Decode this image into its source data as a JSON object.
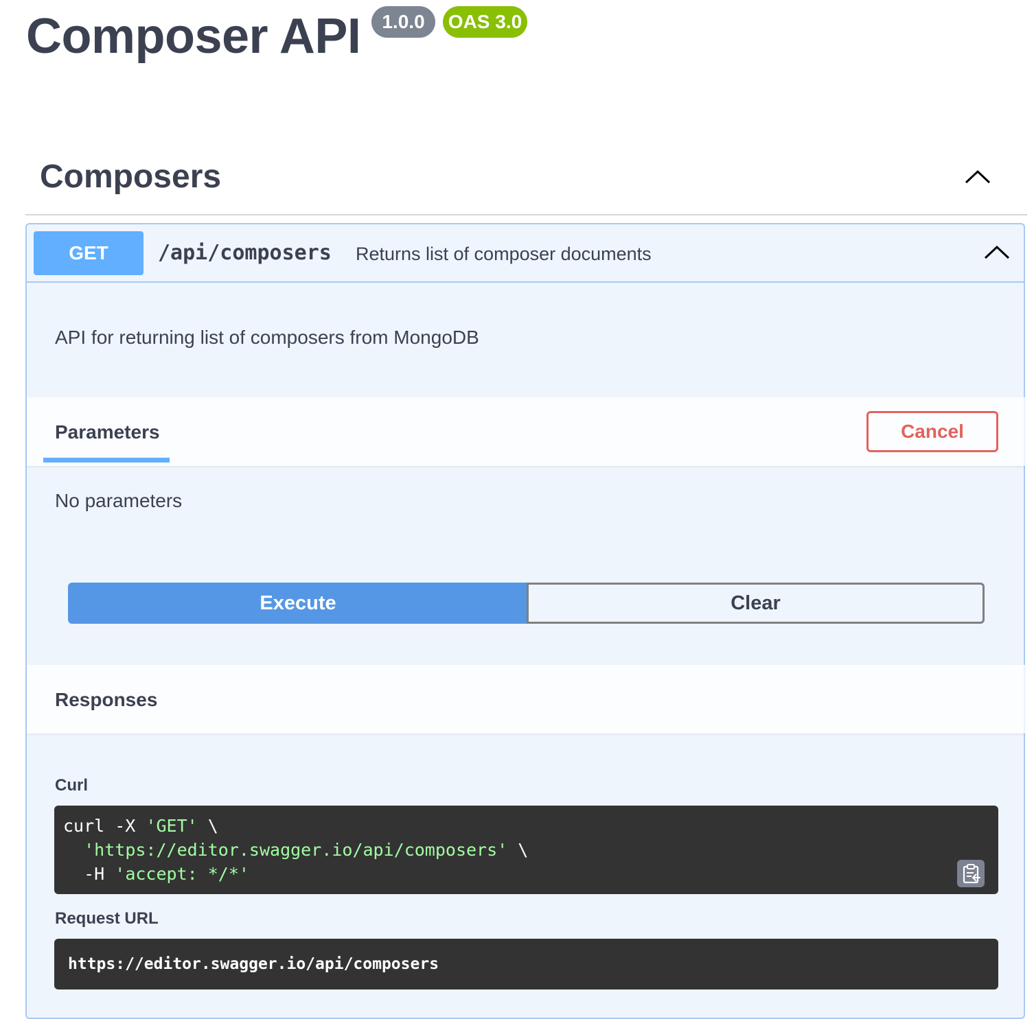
{
  "header": {
    "title": "Composer API",
    "version_badge": "1.0.0",
    "oas_badge": "OAS 3.0"
  },
  "tag": {
    "name": "Composers",
    "chevron_icon": "chevron-up-icon"
  },
  "operation": {
    "method": "GET",
    "path": "/api/composers",
    "summary": "Returns list of composer documents",
    "description": "API for returning list of composers from MongoDB",
    "chevron_icon": "chevron-up-icon",
    "method_color": "#61affe"
  },
  "parameters": {
    "tab_label": "Parameters",
    "cancel_label": "Cancel",
    "empty_text": "No parameters"
  },
  "actions": {
    "execute_label": "Execute",
    "clear_label": "Clear"
  },
  "responses": {
    "title": "Responses",
    "curl_label": "Curl",
    "curl": {
      "line1_cmd": "curl -X ",
      "line1_str": "'GET'",
      "line1_tail": " \\",
      "line2_indent": "  ",
      "line2_str": "'https://editor.swagger.io/api/composers'",
      "line2_tail": " \\",
      "line3_cmd": "  -H ",
      "line3_str": "'accept: */*'"
    },
    "copy_icon": "clipboard-icon",
    "request_url_label": "Request URL",
    "request_url": "https://editor.swagger.io/api/composers"
  },
  "colors": {
    "accent_blue": "#61affe",
    "execute_blue": "#4990e2",
    "cancel_red": "#e2625d",
    "oas_green": "#89bf04",
    "version_grey": "#7d8492",
    "code_bg": "#333333",
    "code_string": "#a2fca2"
  }
}
